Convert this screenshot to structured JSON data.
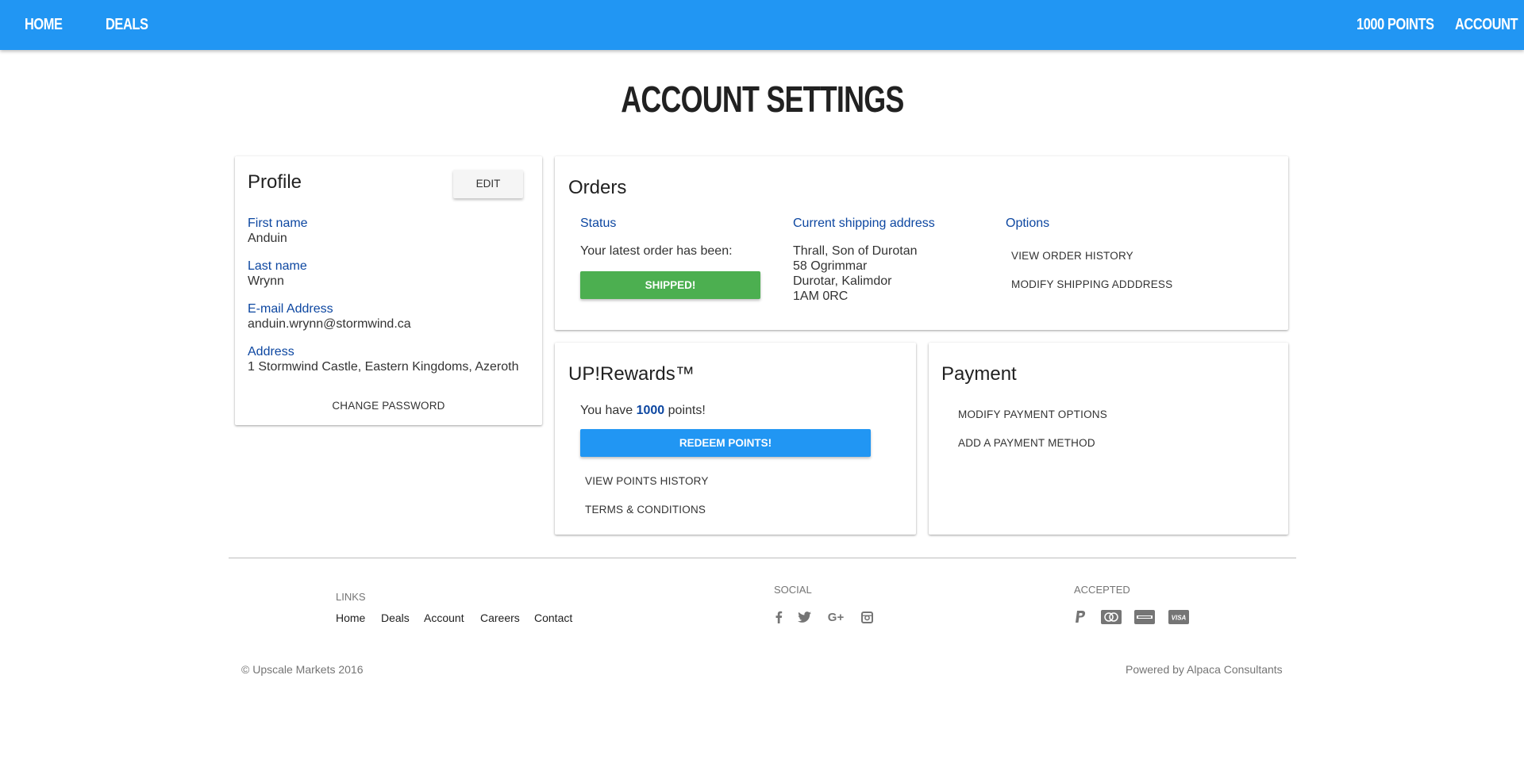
{
  "nav": {
    "home": "HOME",
    "deals": "DEALS",
    "points": "1000 POINTS",
    "account": "ACCOUNT"
  },
  "page_title": "ACCOUNT SETTINGS",
  "profile": {
    "title": "Profile",
    "edit_label": "EDIT",
    "first_name_label": "First name",
    "first_name": "Anduin",
    "last_name_label": "Last name",
    "last_name": "Wrynn",
    "email_label": "E-mail Address",
    "email": "anduin.wrynn@stormwind.ca",
    "address_label": "Address",
    "address": "1 Stormwind Castle, Eastern Kingdoms, Azeroth",
    "change_password": "CHANGE PASSWORD"
  },
  "orders": {
    "title": "Orders",
    "status_label": "Status",
    "status_text": "Your latest order has been:",
    "status_badge": "SHIPPED!",
    "shipping_label": "Current shipping address",
    "shipping_lines": [
      "Thrall, Son of Durotan",
      "58 Ogrimmar",
      "Durotar, Kalimdor",
      "1AM 0RC"
    ],
    "options_label": "Options",
    "view_history": "VIEW ORDER HISTORY",
    "modify_shipping": "MODIFY SHIPPING ADDDRESS"
  },
  "rewards": {
    "title": "UP!Rewards™",
    "points_prefix": "You have",
    "points_value": "1000",
    "points_suffix": "points!",
    "redeem": "REDEEM POINTS!",
    "view_history": "VIEW POINTS HISTORY",
    "terms": "TERMS & CONDITIONS"
  },
  "payment": {
    "title": "Payment",
    "modify": "MODIFY PAYMENT OPTIONS",
    "add": "ADD A PAYMENT METHOD"
  },
  "footer": {
    "links_heading": "LINKS",
    "links": [
      "Home",
      "Deals",
      "Account",
      "Careers",
      "Contact"
    ],
    "social_heading": "SOCIAL",
    "social_icons": [
      "facebook-icon",
      "twitter-icon",
      "google-plus-icon",
      "instagram-icon"
    ],
    "accepted_heading": "ACCEPTED",
    "payment_icons": [
      "paypal-icon",
      "mastercard-icon",
      "amex-icon",
      "visa-icon"
    ],
    "copyright": "© Upscale Markets 2016",
    "powered_by": "Powered by Alpaca Consultants"
  },
  "colors": {
    "primary": "#2196f3",
    "success": "#4caf50",
    "label_blue": "#0d47a1"
  }
}
